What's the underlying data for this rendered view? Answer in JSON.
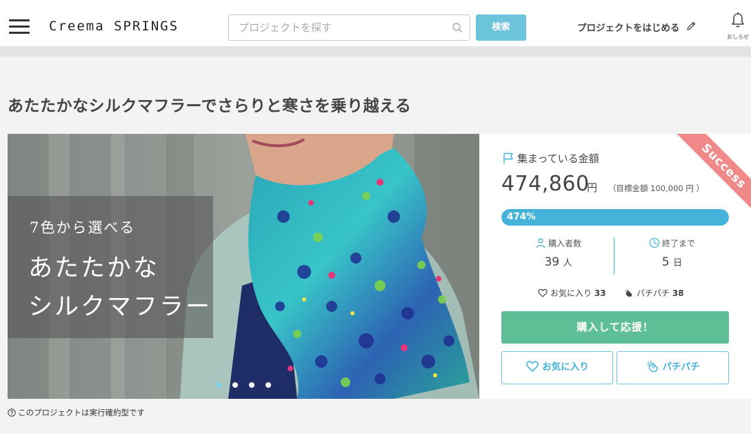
{
  "header": {
    "logo": "Creema SPRINGS",
    "search_placeholder": "プロジェクトを探す",
    "search_button": "検索",
    "start_project": "プロジェクトをはじめる",
    "notifications_label": "おしらせ"
  },
  "project": {
    "title": "あたたかなシルクマフラーでさらりと寒さを乗り越える",
    "hero": {
      "subtitle": "7色から選べる",
      "line1": "あたたかな",
      "line2": "シルクマフラー",
      "slide_count": 4,
      "active_slide": 1
    },
    "note": "このプロジェクトは実行確約型です"
  },
  "funding": {
    "badge": "Success",
    "raised_label": "集まっている金額",
    "amount": "474,860",
    "currency": "円",
    "goal_text": "（目標金額 100,000 円 ）",
    "progress_percent": 474,
    "progress_label": "474%",
    "buyers_label": "購入者数",
    "buyers_value": "39",
    "buyers_unit": "人",
    "remaining_label": "終了まで",
    "remaining_value": "5",
    "remaining_unit": "日",
    "favorites_label": "お気に入り",
    "favorites_count": "33",
    "pachi_label": "パチパチ",
    "pachi_count": "38",
    "buy_button": "購入して応援！",
    "favorite_button": "お気に入り",
    "pachi_button": "パチパチ"
  },
  "colors": {
    "accent": "#45b3d9",
    "buy_green": "#5ebe95",
    "success_ribbon": "#f08a8a"
  },
  "icons": [
    "menu-icon",
    "search-icon",
    "pencil-icon",
    "bell-icon",
    "flag-icon",
    "person-icon",
    "clock-icon",
    "heart-icon",
    "clap-icon",
    "help-icon"
  ]
}
